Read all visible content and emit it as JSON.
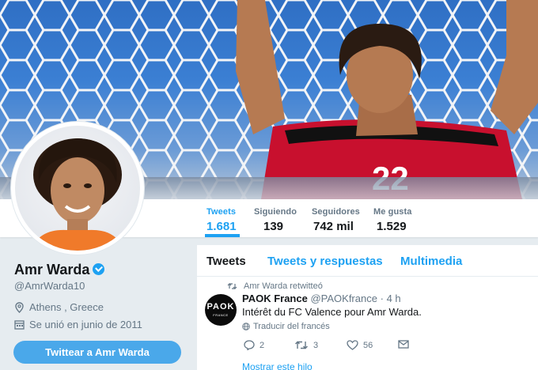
{
  "profile": {
    "name": "Amr Warda",
    "handle": "@AmrWarda10",
    "location": "Athens , Greece",
    "joined": "Se unió en junio de 2011",
    "tweet_to_button": "Twittear a Amr Warda"
  },
  "stats": [
    {
      "label": "Tweets",
      "value": "1.681"
    },
    {
      "label": "Siguiendo",
      "value": "139"
    },
    {
      "label": "Seguidores",
      "value": "742 mil"
    },
    {
      "label": "Me gusta",
      "value": "1.529"
    }
  ],
  "timeline": {
    "tabs": [
      "Tweets",
      "Tweets y respuestas",
      "Multimedia"
    ],
    "retweet_notice": "Amr Warda retwitteó",
    "tweet": {
      "avatar_text": "PAOK",
      "avatar_subtext": "FRANCE",
      "author_name": "PAOK France",
      "author_handle": "@PAOKfrance",
      "separator": "·",
      "time": "4 h",
      "text": "Intérêt du FC Valence pour Amr Warda.",
      "translate_label": "Traducir del francés",
      "replies": "2",
      "retweets": "3",
      "likes": "56"
    },
    "show_thread": "Mostrar este hilo"
  },
  "colors": {
    "accent": "#1da1f2",
    "background": "#e6ecf0",
    "verified": "#1da1f2",
    "kit_red": "#c8102e"
  }
}
